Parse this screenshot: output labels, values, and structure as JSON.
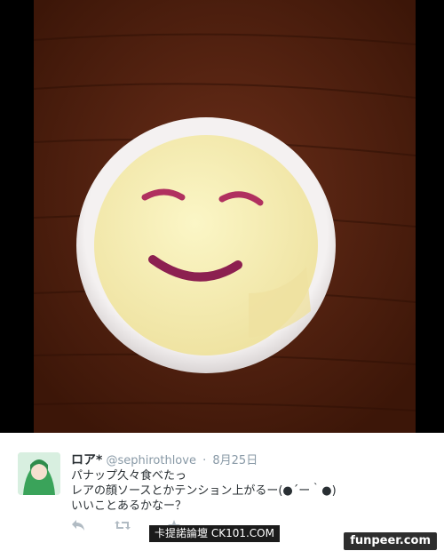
{
  "tweet": {
    "display_name": "ロア*",
    "username": "@sephirothlove",
    "separator": "·",
    "date": "8月25日",
    "lines": [
      "パナップ久々食べたっ",
      "レアの顔ソースとかテンション上がるー(●´ー｀●)",
      "いいことあるかなー？"
    ]
  },
  "icons": {
    "reply": "reply-icon",
    "retweet": "retweet-icon",
    "favorite": "star-icon"
  },
  "watermarks": {
    "ck101": "卡提諾論壇 CK101.COM",
    "funpeer": "funpeer.com"
  },
  "colors": {
    "table_wood": "#5a2614",
    "cup_rim": "#f2efef",
    "ice_cream": "#f7efb3",
    "berry_sauce": "#b0305f",
    "meta_gray": "#8899a6",
    "text_dark": "#292f33"
  }
}
